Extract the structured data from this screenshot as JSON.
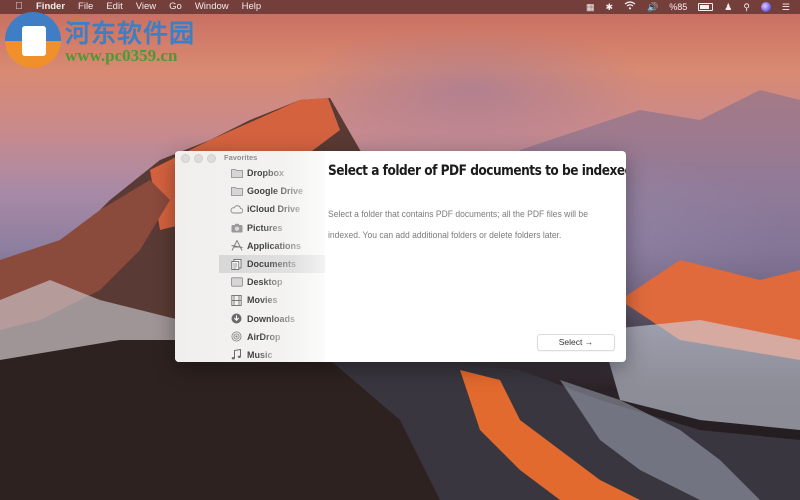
{
  "menubar": {
    "apple_icon": "apple-logo-icon",
    "app_name": "Finder",
    "menus": [
      "File",
      "Edit",
      "View",
      "Go",
      "Window",
      "Help"
    ],
    "status": {
      "battery_percent": "%85",
      "icons": [
        "script-icon",
        "bluetooth-icon",
        "wifi-icon",
        "volume-icon",
        "battery-icon",
        "user-icon",
        "spotlight-search-icon",
        "siri-icon",
        "notification-center-icon"
      ]
    }
  },
  "watermark": {
    "title": "河东软件园",
    "url": "www.pc0359.cn"
  },
  "window": {
    "sidebar": {
      "header": "Favorites",
      "items": [
        {
          "label": "Dropbox",
          "icon": "folder-icon",
          "selected": false
        },
        {
          "label": "Google Drive",
          "icon": "folder-icon",
          "selected": false
        },
        {
          "label": "iCloud Drive",
          "icon": "cloud-icon",
          "selected": false
        },
        {
          "label": "Pictures",
          "icon": "camera-icon",
          "selected": false
        },
        {
          "label": "Applications",
          "icon": "applications-icon",
          "selected": false
        },
        {
          "label": "Documents",
          "icon": "documents-icon",
          "selected": true
        },
        {
          "label": "Desktop",
          "icon": "desktop-icon",
          "selected": false
        },
        {
          "label": "Movies",
          "icon": "film-icon",
          "selected": false
        },
        {
          "label": "Downloads",
          "icon": "download-icon",
          "selected": false
        },
        {
          "label": "AirDrop",
          "icon": "airdrop-icon",
          "selected": false
        },
        {
          "label": "Music",
          "icon": "music-note-icon",
          "selected": false
        }
      ]
    },
    "title": "Select a folder of PDF documents to be indexed",
    "description": "Select a folder that contains PDF documents; all the PDF files will be indexed. You can add additional folders or delete folders later.",
    "select_button": "Select →"
  }
}
